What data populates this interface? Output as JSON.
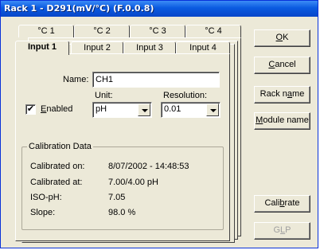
{
  "window": {
    "title": "Rack 1 - D291(mV/°C) (F.0.0.8)"
  },
  "tabs_back": [
    "°C 1",
    "°C 2",
    "°C 3",
    "°C 4"
  ],
  "tabs_front": [
    "Input 1",
    "Input 2",
    "Input 3",
    "Input 4"
  ],
  "form": {
    "name_label": "Name:",
    "name_value": "CH1",
    "unit_label": "Unit:",
    "unit_value": "pH",
    "resolution_label": "Resolution:",
    "resolution_value": "0.01",
    "enabled_label_pre": "",
    "enabled_label_hot": "E",
    "enabled_label_post": "nabled",
    "enabled_checked": "✔"
  },
  "calibration": {
    "legend": "Calibration Data",
    "rows": [
      {
        "label": "Calibrated on:",
        "value": "8/07/2002 - 14:48:53"
      },
      {
        "label": "Calibrated at:",
        "value": "7.00/4.00 pH"
      },
      {
        "label": "ISO-pH:",
        "value": "7.05"
      },
      {
        "label": "Slope:",
        "value": "98.0 %"
      }
    ]
  },
  "buttons": {
    "ok": {
      "pre": "",
      "hot": "O",
      "post": "K"
    },
    "cancel": {
      "pre": "",
      "hot": "C",
      "post": "ancel"
    },
    "rack_name": {
      "pre": "Rack n",
      "hot": "a",
      "post": "me"
    },
    "module_name": {
      "pre": "",
      "hot": "M",
      "post": "odule name"
    },
    "calibrate": {
      "pre": "Cali",
      "hot": "b",
      "post": "rate"
    },
    "glp": {
      "pre": "G",
      "hot": "L",
      "post": "P"
    }
  }
}
